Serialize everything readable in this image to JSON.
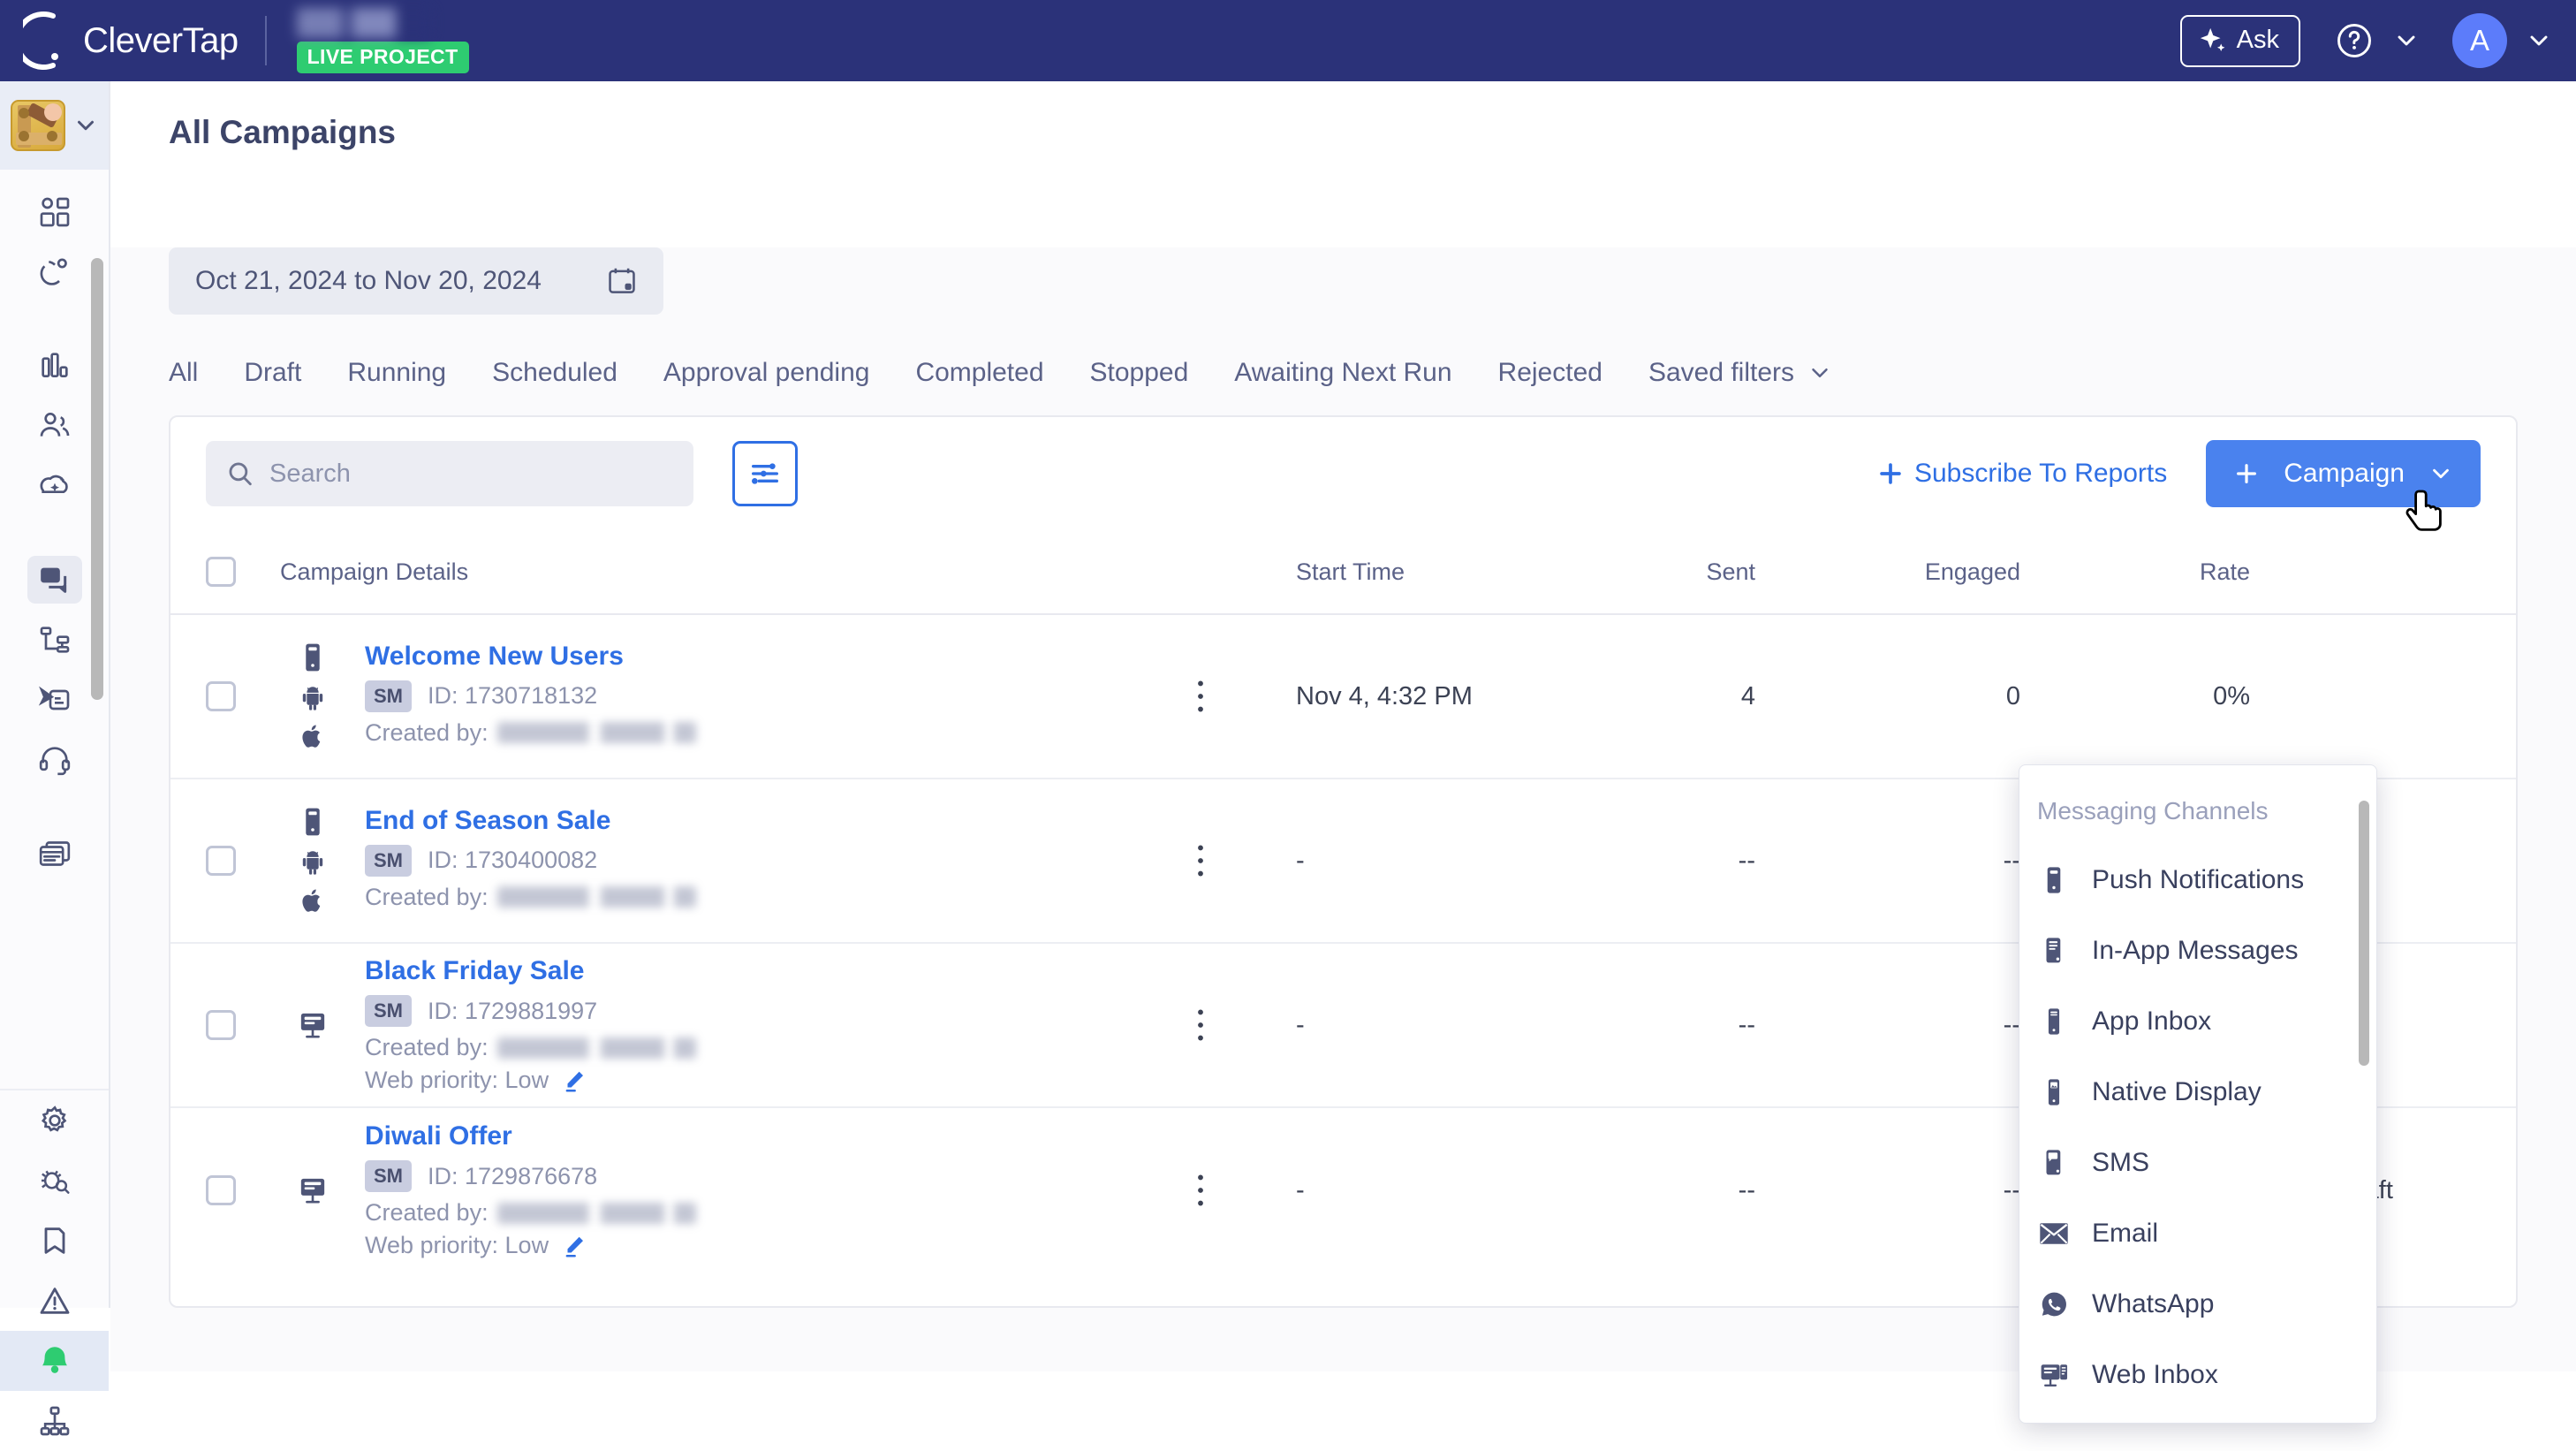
{
  "header": {
    "brand": "CleverTap",
    "project_badge": "LIVE PROJECT",
    "ask_label": "Ask",
    "avatar_initial": "A",
    "icons": {
      "help": "help-circle-icon",
      "sparkle": "sparkle-icon"
    },
    "bg_color": "#2b3279",
    "badge_color": "#2ecc71"
  },
  "sidebar": {
    "app_name": "app-switcher",
    "items": [
      {
        "name": "dashboards",
        "icon": "dashboard-icon"
      },
      {
        "name": "acquire",
        "icon": "magnet-icon"
      },
      {
        "name": "analytics",
        "icon": "bar-chart-icon"
      },
      {
        "name": "segments",
        "icon": "users-icon"
      },
      {
        "name": "clever-ai",
        "icon": "sparkle-cloud-icon"
      },
      {
        "name": "campaigns",
        "icon": "messages-icon",
        "active": true
      },
      {
        "name": "journeys",
        "icon": "flow-icon"
      },
      {
        "name": "templates",
        "icon": "send-template-icon"
      },
      {
        "name": "support",
        "icon": "headset-icon"
      },
      {
        "name": "web-pages",
        "icon": "browser-icon"
      },
      {
        "name": "settings",
        "icon": "gear-icon"
      },
      {
        "name": "debug",
        "icon": "bug-search-icon"
      },
      {
        "name": "bookmarks",
        "icon": "bookmark-icon"
      },
      {
        "name": "alerts",
        "icon": "warning-triangle-icon"
      },
      {
        "name": "notifications",
        "icon": "bell-icon",
        "color": "#2ecc71"
      },
      {
        "name": "hierarchy",
        "icon": "org-chart-icon"
      }
    ]
  },
  "page": {
    "title": "All Campaigns",
    "date_range": "Oct 21, 2024 to Nov 20, 2024",
    "calendar_icon": "calendar-icon"
  },
  "tabs": [
    {
      "label": "All",
      "active": true
    },
    {
      "label": "Draft"
    },
    {
      "label": "Running"
    },
    {
      "label": "Scheduled"
    },
    {
      "label": "Approval pending"
    },
    {
      "label": "Completed"
    },
    {
      "label": "Stopped"
    },
    {
      "label": "Awaiting Next Run"
    },
    {
      "label": "Rejected"
    },
    {
      "label": "Saved filters",
      "chevron": true
    }
  ],
  "toolbar": {
    "search_placeholder": "Search",
    "search_value": "",
    "search_icon": "search-icon",
    "filter_icon": "sliders-icon",
    "subscribe_label": "Subscribe To Reports",
    "campaign_label": "Campaign",
    "plus": "+",
    "campaign_btn_color": "#4a82ee",
    "link_color": "#2f6fe4"
  },
  "table": {
    "columns": [
      "Campaign Details",
      "Start Time",
      "Sent",
      "Engaged",
      "Rate"
    ],
    "rows": [
      {
        "name": "Welcome New Users",
        "badge": "SM",
        "id_label": "ID: 1730718132",
        "created_label": "Created by:",
        "platforms": [
          "push-icon",
          "android-icon",
          "apple-icon"
        ],
        "start_time": "Nov 4, 4:32 PM",
        "sent": "4",
        "engaged": "0",
        "rate": "0%",
        "status": ""
      },
      {
        "name": "End of Season Sale",
        "badge": "SM",
        "id_label": "ID: 1730400082",
        "created_label": "Created by:",
        "platforms": [
          "push-icon",
          "android-icon",
          "apple-icon"
        ],
        "start_time": "-",
        "sent": "--",
        "engaged": "--",
        "rate": "--",
        "status": ""
      },
      {
        "name": "Black Friday Sale",
        "badge": "SM",
        "id_label": "ID: 1729881997",
        "created_label": "Created by:",
        "web_priority": "Web priority: Low",
        "edit_icon": "pencil-icon",
        "platforms": [
          "web-inbox-icon"
        ],
        "start_time": "-",
        "sent": "--",
        "engaged": "--",
        "rate": "--",
        "status": ""
      },
      {
        "name": "Diwali Offer",
        "badge": "SM",
        "id_label": "ID: 1729876678",
        "created_label": "Created by:",
        "web_priority": "Web priority: Low",
        "edit_icon": "pencil-icon",
        "platforms": [
          "web-inbox-icon"
        ],
        "start_time": "-",
        "sent": "--",
        "engaged": "--",
        "rate": "--",
        "status": "Draft"
      }
    ]
  },
  "dropdown": {
    "title": "Messaging Channels",
    "items": [
      {
        "label": "Push Notifications",
        "icon": "push-notification-icon"
      },
      {
        "label": "In-App Messages",
        "icon": "in-app-message-icon"
      },
      {
        "label": "App Inbox",
        "icon": "app-inbox-icon"
      },
      {
        "label": "Native Display",
        "icon": "native-display-icon"
      },
      {
        "label": "SMS",
        "icon": "sms-icon"
      },
      {
        "label": "Email",
        "icon": "email-icon"
      },
      {
        "label": "WhatsApp",
        "icon": "whatsapp-icon"
      },
      {
        "label": "Web Inbox",
        "icon": "web-inbox-icon"
      }
    ]
  }
}
